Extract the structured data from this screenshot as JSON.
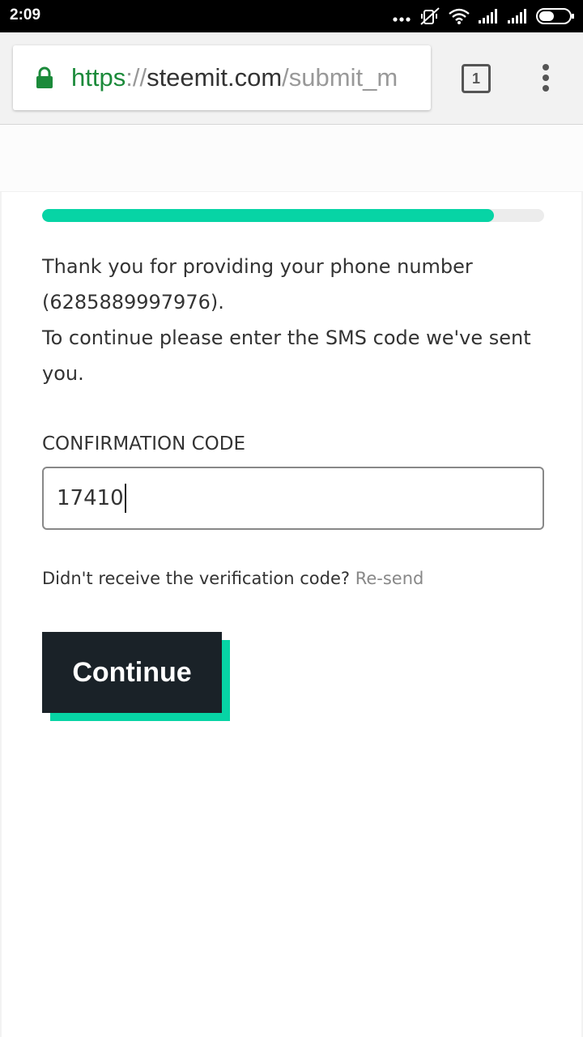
{
  "status_bar": {
    "time": "2:09",
    "icons": [
      "more-dots-icon",
      "mute-vibrate-icon",
      "wifi-icon",
      "signal-icon",
      "signal-icon",
      "battery-icon"
    ]
  },
  "browser": {
    "url_scheme": "https",
    "url_separator": "://",
    "url_host": "steemit.com",
    "url_path": "/submit_m",
    "tab_count": "1",
    "lock_color": "#1b8a3a"
  },
  "progress": {
    "fraction": 0.9,
    "color": "#07d4a5"
  },
  "message": {
    "line1": "Thank you for providing your phone number (6285889997976).",
    "line2": "To continue please enter the SMS code we've sent you."
  },
  "form": {
    "label": "CONFIRMATION CODE",
    "code_value": "17410"
  },
  "resend": {
    "text": "Didn't receive the verification code? ",
    "link_label": "Re-send"
  },
  "continue_button": {
    "label": "Continue",
    "bg_color": "#1a2228",
    "shadow_color": "#07d4a5"
  }
}
